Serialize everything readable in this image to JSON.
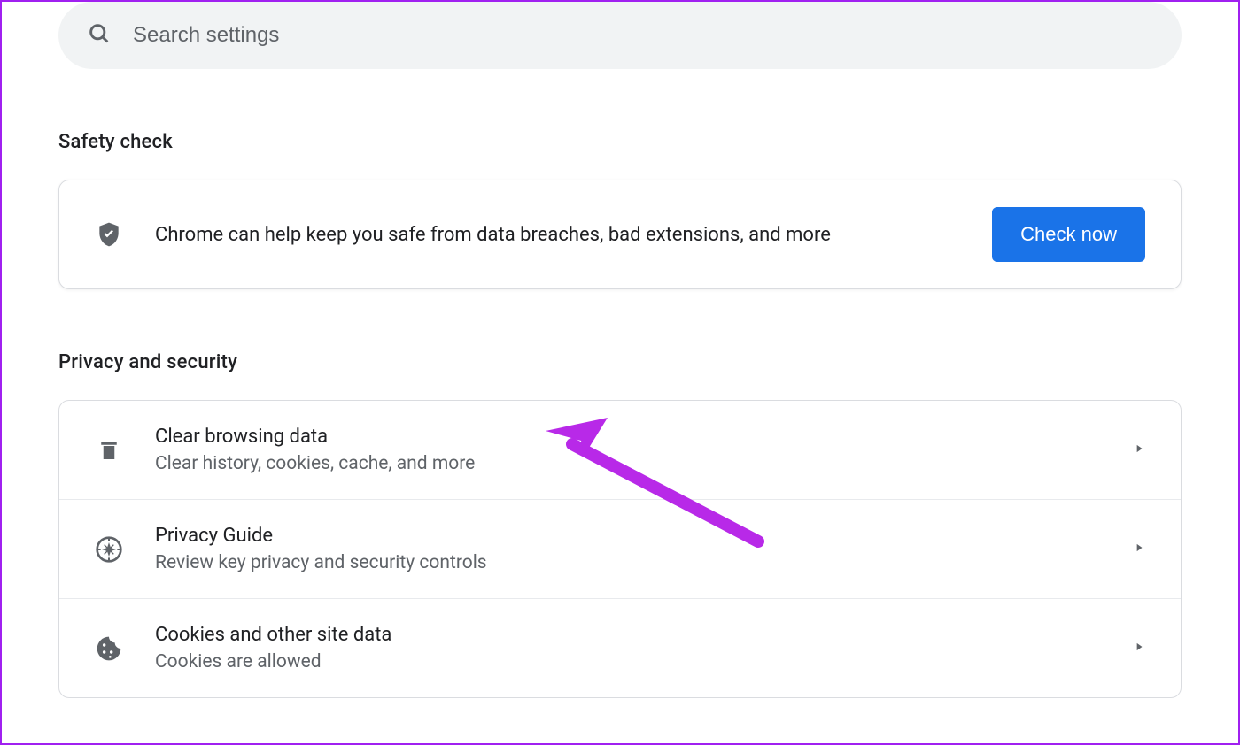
{
  "search": {
    "placeholder": "Search settings"
  },
  "sections": {
    "safety_check": {
      "title": "Safety check",
      "description": "Chrome can help keep you safe from data breaches, bad extensions, and more",
      "button_label": "Check now"
    },
    "privacy": {
      "title": "Privacy and security",
      "items": [
        {
          "title": "Clear browsing data",
          "subtitle": "Clear history, cookies, cache, and more",
          "icon": "trash-icon"
        },
        {
          "title": "Privacy Guide",
          "subtitle": "Review key privacy and security controls",
          "icon": "compass-icon"
        },
        {
          "title": "Cookies and other site data",
          "subtitle": "Cookies are allowed",
          "icon": "cookie-icon"
        }
      ]
    }
  }
}
